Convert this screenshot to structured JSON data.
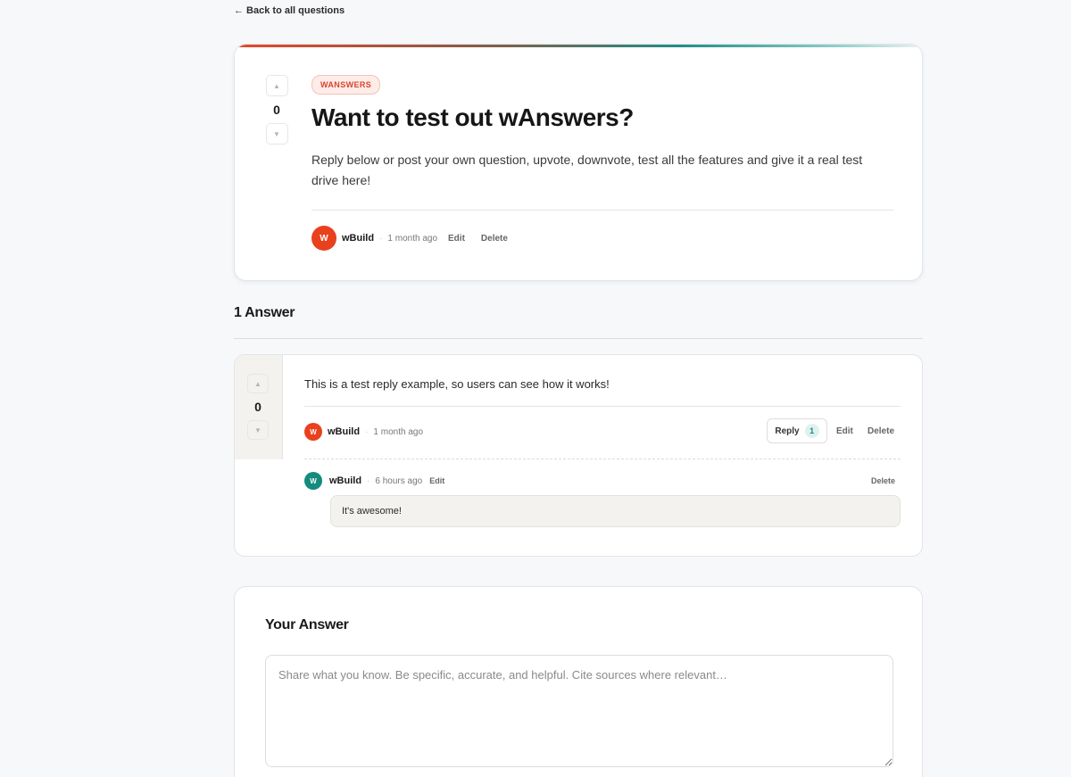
{
  "nav": {
    "back_label": "← Back to all questions"
  },
  "question": {
    "votes": "0",
    "tag": "WANSWERS",
    "title": "Want to test out wAnswers?",
    "body": "Reply below or post your own question, upvote, downvote, test all the features and give it a real test drive here!",
    "author_initial": "W",
    "author": "wBuild",
    "time": "1 month ago",
    "edit_label": "Edit",
    "delete_label": "Delete"
  },
  "answers_header": "1 Answer",
  "answer": {
    "votes": "0",
    "text": "This is a test reply example, so users can see how it works!",
    "author_initial": "W",
    "author": "wBuild",
    "time": "1 month ago",
    "reply_label": "Reply",
    "reply_count": "1",
    "edit_label": "Edit",
    "delete_label": "Delete",
    "reply": {
      "author_initial": "W",
      "author": "wBuild",
      "time": "6 hours ago",
      "edit_label": "Edit",
      "delete_label": "Delete",
      "text": "It's awesome!"
    }
  },
  "your_answer": {
    "title": "Your Answer",
    "placeholder": "Share what you know. Be specific, accurate, and helpful. Cite sources where relevant…"
  },
  "colors": {
    "accent_red": "#e9401e",
    "accent_teal": "#138b7d"
  }
}
